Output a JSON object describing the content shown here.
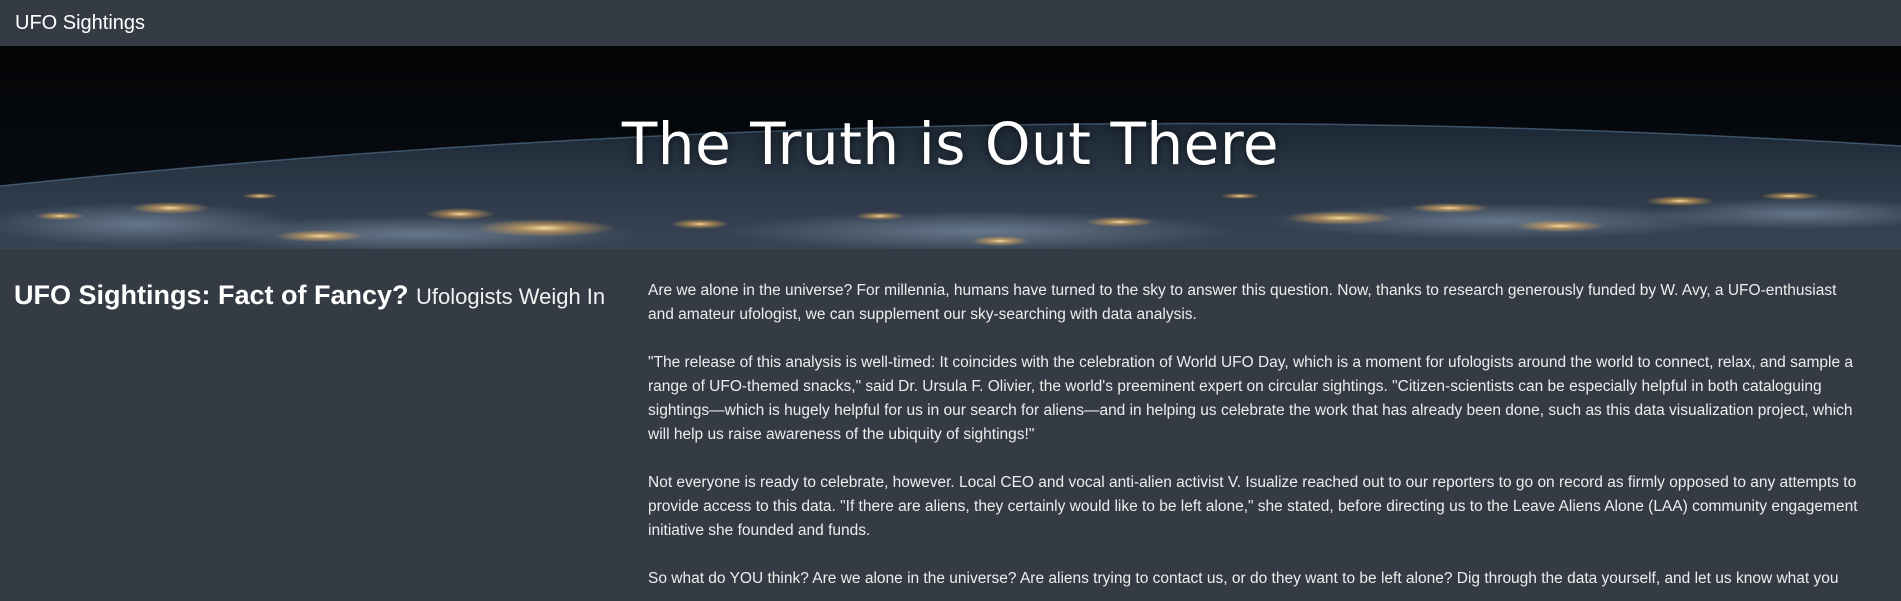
{
  "navbar": {
    "brand": "UFO Sightings"
  },
  "hero": {
    "title": "The Truth is Out There"
  },
  "article": {
    "heading": "UFO Sightings: Fact of Fancy?",
    "subheading": "Ufologists Weigh In",
    "paragraphs": [
      "Are we alone in the universe? For millennia, humans have turned to the sky to answer this question. Now, thanks to research generously funded by W. Avy, a UFO-enthusiast and amateur ufologist, we can supplement our sky-searching with data analysis.",
      "\"The release of this analysis is well-timed: It coincides with the celebration of World UFO Day, which is a moment for ufologists around the world to connect, relax, and sample a range of UFO-themed snacks,\" said Dr. Ursula F. Olivier, the world's preeminent expert on circular sightings. \"Citizen-scientists can be especially helpful in both cataloguing sightings—which is hugely helpful for us in our search for aliens—and in helping us celebrate the work that has already been done, such as this data visualization project, which will help us raise awareness of the ubiquity of sightings!\"",
      "Not everyone is ready to celebrate, however. Local CEO and vocal anti-alien activist V. Isualize reached out to our reporters to go on record as firmly opposed to any attempts to provide access to this data. \"If there are aliens, they certainly would like to be left alone,\" she stated, before directing us to the Leave Aliens Alone (LAA) community engagement initiative she founded and funds.",
      "So what do YOU think? Are we alone in the universe? Are aliens trying to contact us, or do they want to be left alone? Dig through the data yourself, and let us know what you"
    ]
  }
}
